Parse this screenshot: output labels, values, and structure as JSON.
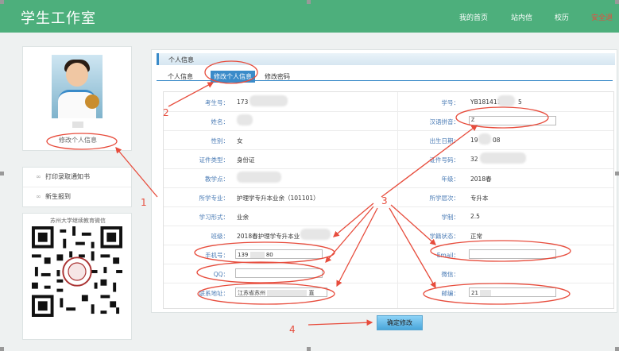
{
  "header": {
    "title": "学生工作室",
    "nav": [
      "我的首页",
      "站内信",
      "校历",
      "安全退"
    ]
  },
  "sidebar": {
    "edit_profile_link": "修改个人信息",
    "menu": [
      {
        "label": "打印录取通知书",
        "icon": "link-icon"
      },
      {
        "label": "新生报到",
        "icon": "link-icon"
      }
    ],
    "qr_title": "苏州大学继续教育微信"
  },
  "panel": {
    "title": "个人信息",
    "tabs": [
      "个人信息",
      "修改个人信息",
      "修改密码"
    ]
  },
  "form": {
    "exam_no_label": "考生号：",
    "exam_no_value": "173",
    "student_no_label": "学号：",
    "student_no_value": "YB181411",
    "student_no_suffix": "5",
    "name_label": "姓名：",
    "pinyin_label": "汉语拼音：",
    "pinyin_value": "Z",
    "gender_label": "性别：",
    "gender_value": "女",
    "birth_label": "出生日期：",
    "birth_value": "19",
    "birth_suffix": "08",
    "id_type_label": "证件类型：",
    "id_type_value": "身份证",
    "id_no_label": "证件号码：",
    "id_no_value": "32",
    "center_label": "教学点：",
    "grade_label": "年级：",
    "grade_value": "2018春",
    "major_label": "所学专业：",
    "major_value": "护理学专升本业余（101101）",
    "level_label": "所学层次：",
    "level_value": "专升本",
    "study_form_label": "学习形式：",
    "study_form_value": "业余",
    "duration_label": "学制：",
    "duration_value": "2.5",
    "class_label": "班级：",
    "class_value": "2018春护理学专升本业",
    "status_label": "学籍状态：",
    "status_value": "正常",
    "phone_label": "手机号：",
    "phone_value": "139",
    "phone_suffix": "80",
    "email_label": "Email：",
    "email_value": "",
    "qq_label": "QQ：",
    "qq_value": "",
    "wechat_label": "微信：",
    "address_label": "联系地址：",
    "address_value": "江苏省苏州",
    "address_suffix": "直",
    "postcode_label": "邮编：",
    "postcode_value": "21"
  },
  "submit_label": "确定修改",
  "annotations": [
    "1",
    "2",
    "3",
    "4"
  ],
  "colors": {
    "header": "#4daf7c",
    "annotation": "#e74c3c",
    "accent": "#3a8bc9"
  }
}
